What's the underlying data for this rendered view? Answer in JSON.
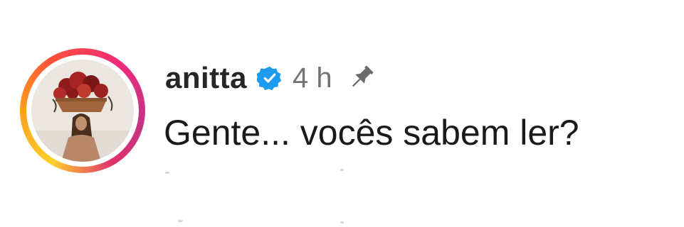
{
  "comment": {
    "username": "anitta",
    "verified_icon": "verified-badge-icon",
    "time_ago": "4 h",
    "pinned_icon": "pin-icon",
    "text": "Gente... vocês sabem ler?",
    "avatar_icon": "profile-avatar",
    "has_story_ring": true
  },
  "colors": {
    "username": "#262626",
    "verified": "#1d9bf0",
    "time": "#737373",
    "text": "#1a1a1a",
    "pin": "#737373"
  }
}
